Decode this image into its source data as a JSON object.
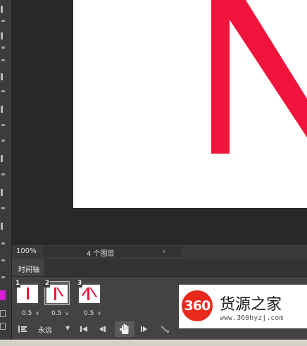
{
  "status_bar": {
    "zoom": "100%",
    "layer_info": "4 个图层",
    "expand_arrow": "›"
  },
  "timeline": {
    "tab_label": "时间轴",
    "frames": [
      {
        "number": "1",
        "delay": "0.5",
        "selected": false
      },
      {
        "number": "2",
        "delay": "0.5",
        "selected": true
      },
      {
        "number": "3",
        "delay": "0.5",
        "selected": false
      }
    ],
    "delay_arrow": "∨",
    "loop_option": "永远",
    "loop_arrow": "▼",
    "controls": {
      "convert_icon": "timeline-convert-icon",
      "first_frame_icon": "first-frame-icon",
      "prev_frame_icon": "previous-frame-icon",
      "hand_icon": "hand-icon",
      "next_frame_icon": "next-frame-icon",
      "tween_icon": "tween-icon"
    }
  },
  "canvas": {
    "letter_color": "#f0143c",
    "doc_bg": "#ffffff"
  },
  "tools": {
    "foreground_color": "#d41dd6"
  },
  "watermark": {
    "badge": "360",
    "title": "货源之家",
    "url": "www.360hyzj.com"
  }
}
